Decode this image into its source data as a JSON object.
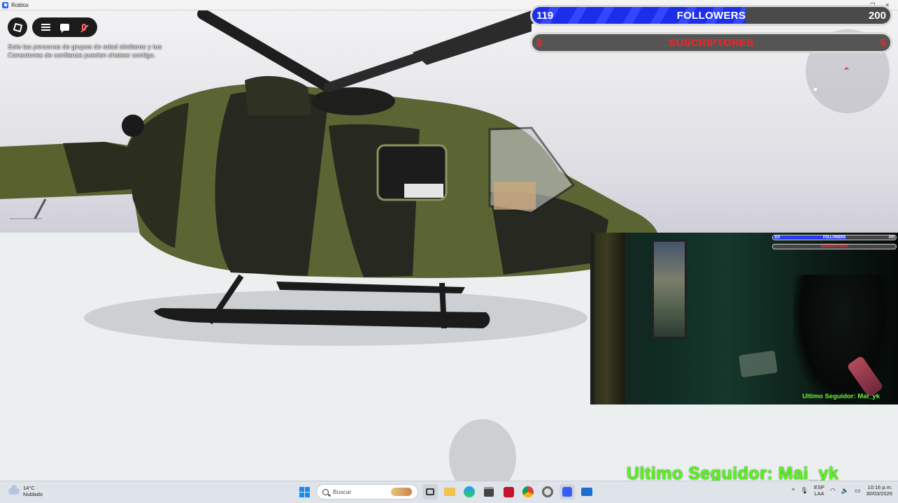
{
  "window": {
    "app_name": "Roblox",
    "controls": [
      "—",
      "❐",
      "✕"
    ]
  },
  "roblox_ui": {
    "notice_text": "Solo las personas de grupos de edad similares y tus Conexiones de confianza pueden chatear contigo."
  },
  "goals": {
    "followers": {
      "current": "119",
      "label": "FOLLOWERS",
      "target": "200",
      "fill_fraction": 0.595,
      "bar_color": "#1d2ee8"
    },
    "subscribers": {
      "current": "0",
      "label": "SUSCRIPTORES",
      "target": "5",
      "fill_fraction": 0.0,
      "text_color": "#ff2020"
    }
  },
  "webcam": {
    "mini_followers": {
      "current": "119",
      "label": "FOLLOWERS",
      "target": "200"
    },
    "mini_subscribers": {
      "label": "SUSCRIPTORES"
    },
    "last_follower": "Ultimo Seguidor: Mai_yk"
  },
  "overlay": {
    "last_follower": "Ultimo Seguidor: Mai_yk",
    "color": "#55f518"
  },
  "taskbar": {
    "weather": {
      "temp": "14°C",
      "condition": "Nublado",
      "icon": "cloud-icon"
    },
    "search": {
      "placeholder": "Buscar"
    },
    "apps": [
      "file-explorer-icon",
      "edge-icon",
      "store-icon",
      "acrobat-icon",
      "chrome-icon",
      "chrome-dev-icon",
      "roblox-icon",
      "tv-app-icon"
    ],
    "tray": {
      "lang_line1": "ESP",
      "lang_line2": "LAA",
      "time": "10:16 p.m.",
      "date": "30/03/2026"
    }
  }
}
